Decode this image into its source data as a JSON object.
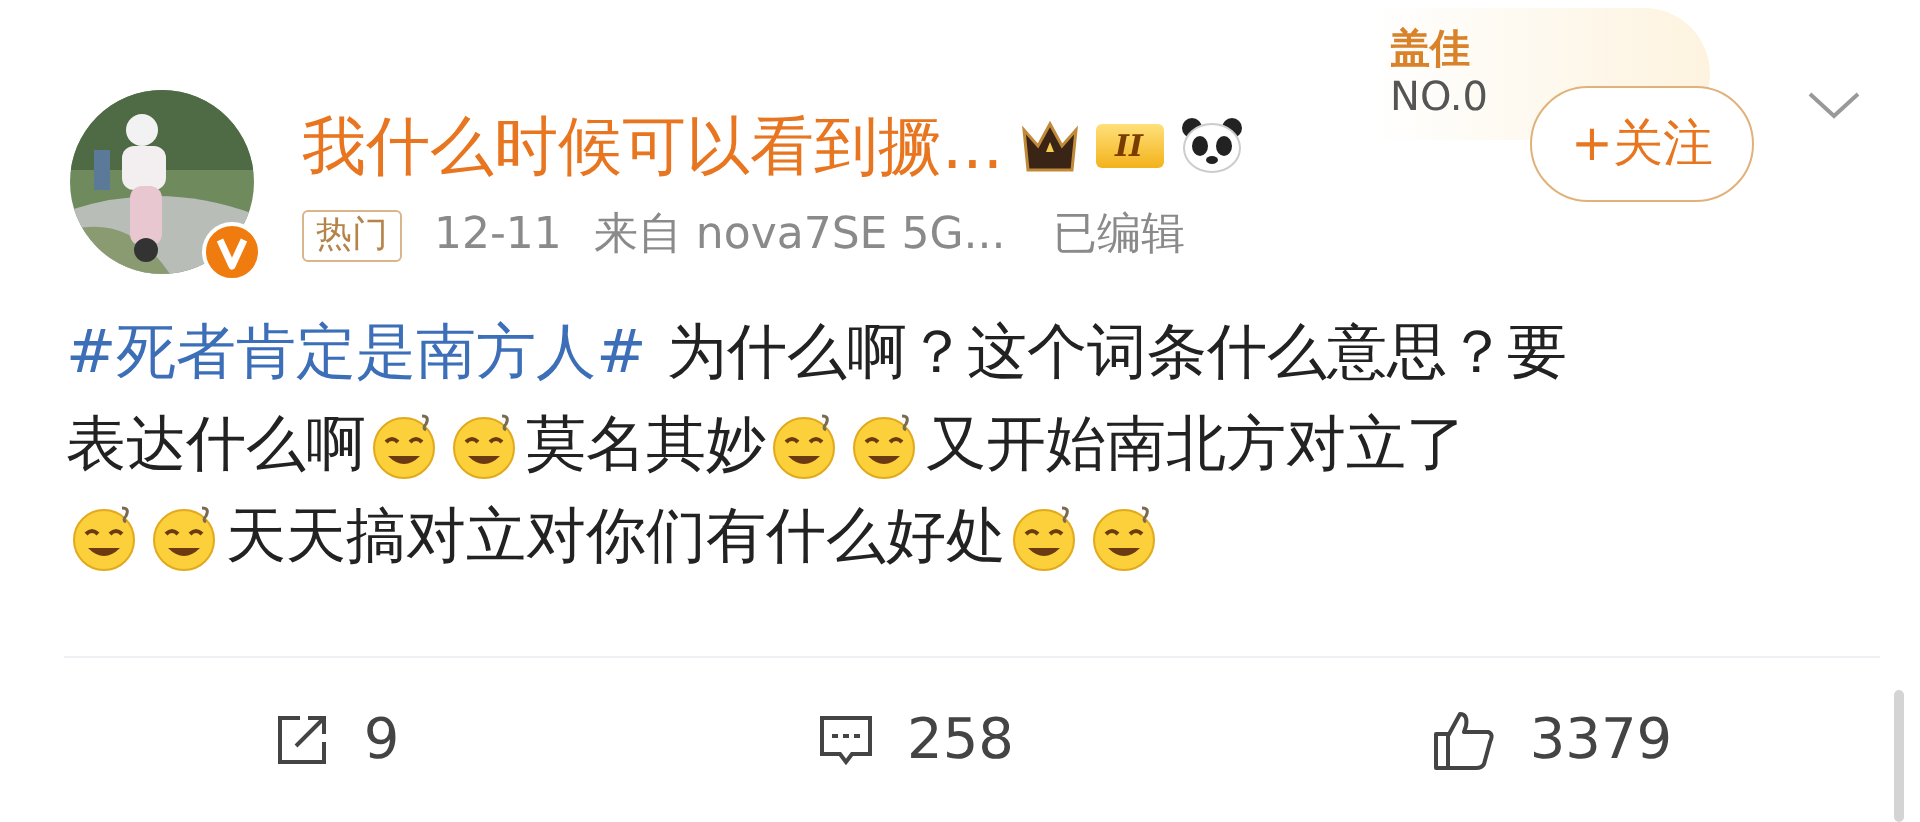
{
  "author": {
    "name": "我什么时候可以看到撅...",
    "verified": true,
    "level_badge": "II",
    "tag": "热门",
    "date": "12-11",
    "source": "来自 nova7SE 5G...",
    "edited": "已编辑"
  },
  "fan_badge": {
    "name": "盖佳",
    "number": "NO.0"
  },
  "follow_button": {
    "label": "+关注"
  },
  "content": [
    [
      {
        "kind": "hashtag",
        "text": "#死者肯定是南方人#"
      },
      {
        "kind": "text",
        "text": "为什么啊？这个词条什么意思？要"
      }
    ],
    [
      {
        "kind": "text",
        "text": "表达什么啊"
      },
      {
        "kind": "emoji"
      },
      {
        "kind": "emoji"
      },
      {
        "kind": "text",
        "text": "莫名其妙"
      },
      {
        "kind": "emoji"
      },
      {
        "kind": "emoji"
      },
      {
        "kind": "text",
        "text": "又开始南北方对立了"
      }
    ],
    [
      {
        "kind": "emoji"
      },
      {
        "kind": "emoji"
      },
      {
        "kind": "text",
        "text": "天天搞对立对你们有什么好处"
      },
      {
        "kind": "emoji"
      },
      {
        "kind": "emoji"
      }
    ]
  ],
  "actions": [
    {
      "kind": "repost",
      "count": "9"
    },
    {
      "kind": "comment",
      "count": "258"
    },
    {
      "kind": "like",
      "count": "3379"
    }
  ]
}
